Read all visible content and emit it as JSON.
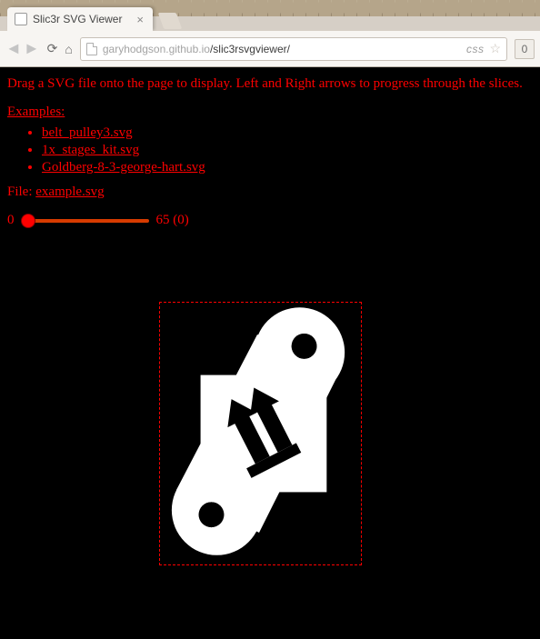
{
  "browser": {
    "tab_title": "Slic3r SVG Viewer",
    "url_host": "garyhodgson.github.io",
    "url_path": "/slic3rsvgviewer/",
    "css_label": "css",
    "ext_badge": "0"
  },
  "page": {
    "instructions": "Drag a SVG file onto the page to display. Left and Right arrows to progress through the slices.",
    "examples_heading": "Examples:",
    "examples": [
      "belt_pulley3.svg",
      "1x_stages_kit.svg",
      "Goldberg-8-3-george-hart.svg"
    ],
    "file_label": "File: ",
    "file_name": "example.svg",
    "slider_min": "0",
    "slider_max": "65",
    "slider_value": "0"
  }
}
